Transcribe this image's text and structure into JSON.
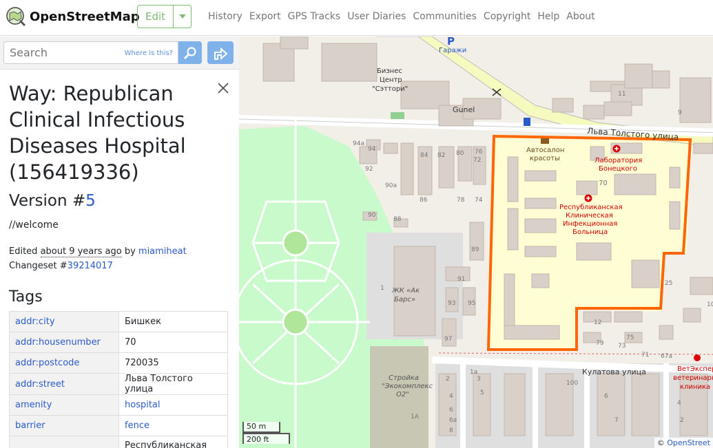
{
  "header": {
    "brand": "OpenStreetMap",
    "edit_label": "Edit",
    "nav": [
      "History",
      "Export",
      "GPS Tracks",
      "User Diaries",
      "Communities",
      "Copyright",
      "Help",
      "About"
    ]
  },
  "search": {
    "placeholder": "Search",
    "where_is_this": "Where is this?"
  },
  "feature": {
    "title": "Way: Republican Clinical Infectious Diseases Hospital (156419336)",
    "version_prefix": "Version #",
    "version_number": "5",
    "comment": "//welcome",
    "edited_prefix": "Edited ",
    "edited_ago": "about 9 years ago",
    "edited_by_text": " by ",
    "edited_user": "miamiheat",
    "changeset_prefix": "Changeset #",
    "changeset_id": "39214017",
    "tags_heading": "Tags",
    "tags": [
      {
        "key": "addr:city",
        "value": "Бишкек"
      },
      {
        "key": "addr:housenumber",
        "value": "70"
      },
      {
        "key": "addr:postcode",
        "value": "720035"
      },
      {
        "key": "addr:street",
        "value": "Льва Толстого улица"
      },
      {
        "key": "amenity",
        "value": "hospital"
      },
      {
        "key": "barrier",
        "value": "fence"
      },
      {
        "key": "",
        "value": "Республиканская"
      }
    ]
  },
  "map": {
    "labels": {
      "garages": "Гаражи",
      "business_center_1": "Бизнес",
      "business_center_2": "Центр",
      "business_center_3": "\"Сэттори\"",
      "gunel": "Gunel",
      "street_tolstoy": "Льва Толстого улица",
      "autosalon_1": "Автосалон",
      "autosalon_2": "красоты",
      "lab_1": "Лаборатория",
      "lab_2": "Бонецкого",
      "hospital_1": "Республиканская",
      "hospital_2": "Клиническая",
      "hospital_3": "Инфекционная",
      "hospital_4": "Больница",
      "zhk_1": "ЖК «Ак",
      "zhk_2": "Барс»",
      "stroyka_1": "Стройка",
      "stroyka_2": "\"Экокомплекс",
      "stroyka_3": "О2\"",
      "street_kulatova": "Кулатова улица",
      "vet_1": "ВетЭкспер",
      "vet_2": "ветеринарн",
      "vet_3": "клиника",
      "house_70": "70"
    },
    "house_numbers": [
      "94а",
      "94",
      "84",
      "82",
      "80",
      "76",
      "72",
      "92",
      "90а",
      "86",
      "78",
      "74",
      "90",
      "88",
      "89",
      "91",
      "93",
      "95",
      "97",
      "11",
      "9",
      "25",
      "12",
      "75",
      "79",
      "73",
      "71",
      "67а",
      "10",
      "1",
      "1а",
      "1А",
      "2",
      "4",
      "6",
      "6а",
      "8",
      "3",
      "5",
      "100",
      "6",
      "7",
      "4",
      "2"
    ],
    "scale_m": "50 m",
    "scale_ft": "200 ft",
    "attribution_prefix": "© ",
    "attribution_link": "OpenStreet"
  },
  "colors": {
    "accent_green": "#7ebc6f",
    "link_blue": "#2a5ac9",
    "highlight_orange": "#ff6600",
    "park_green": "#c8facc"
  }
}
